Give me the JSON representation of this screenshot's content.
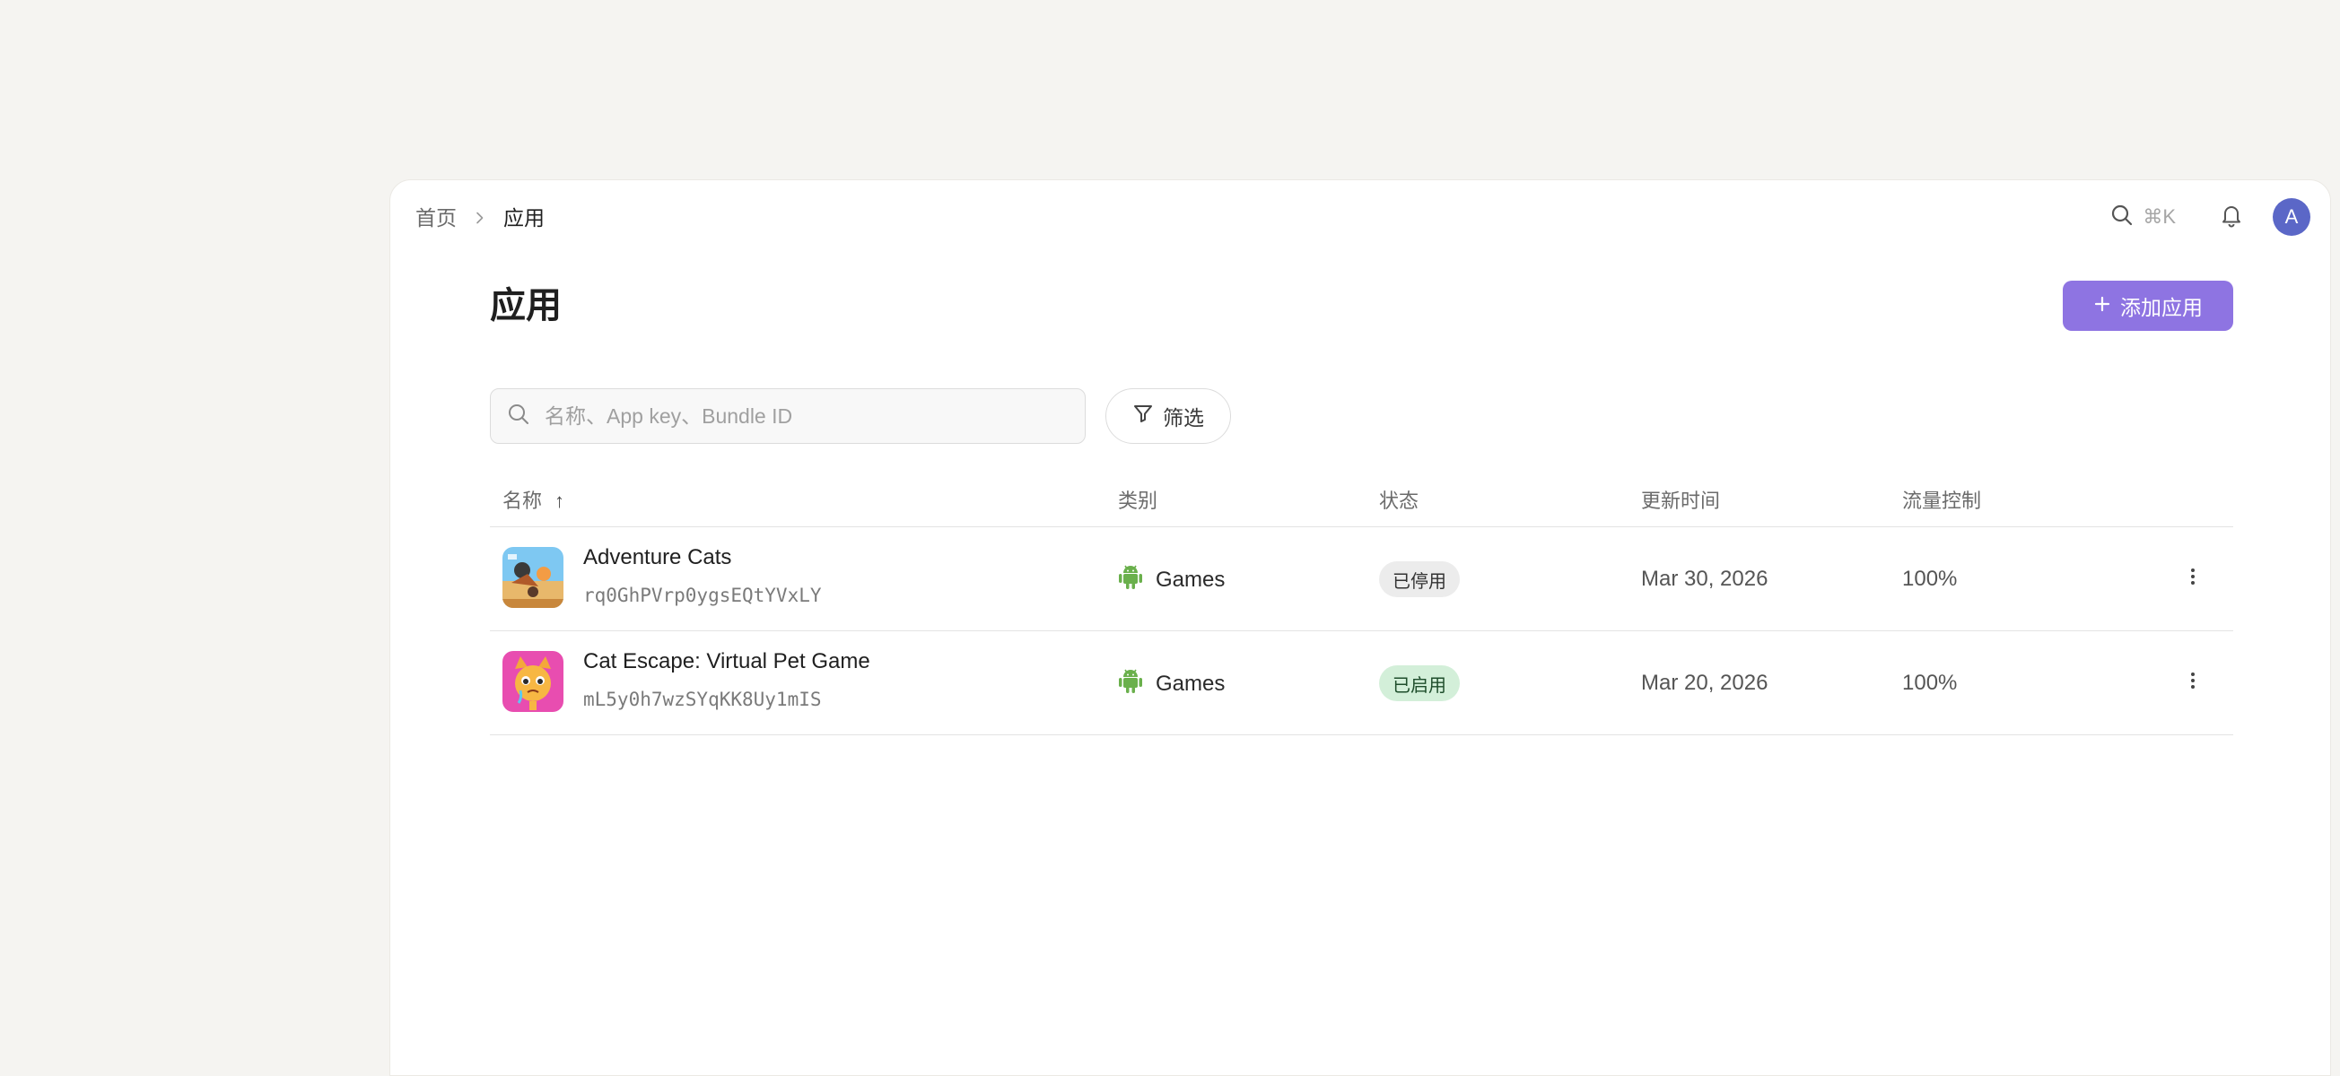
{
  "breadcrumb": {
    "home": "首页",
    "current": "应用"
  },
  "topbar": {
    "search_shortcut": "⌘K",
    "avatar_letter": "A"
  },
  "page": {
    "title": "应用",
    "add_button": "添加应用"
  },
  "search": {
    "placeholder": "名称、App key、Bundle ID",
    "value": ""
  },
  "filter": {
    "label": "筛选"
  },
  "table": {
    "columns": {
      "name": "名称",
      "sort_indicator": "↑",
      "category": "类别",
      "status": "状态",
      "updated": "更新时间",
      "traffic": "流量控制"
    },
    "rows": [
      {
        "name": "Adventure Cats",
        "key": "rq0GhPVrp0ygsEQtYVxLY",
        "platform_icon": "android-icon",
        "category": "Games",
        "status": "已停用",
        "updated": "Mar 30, 2026",
        "traffic": "100%"
      },
      {
        "name": "Cat Escape: Virtual Pet Game",
        "key": "mL5y0h7wzSYqKK8Uy1mIS",
        "platform_icon": "android-icon",
        "category": "Games",
        "status": "已启用",
        "updated": "Mar 20, 2026",
        "traffic": "100%"
      }
    ]
  },
  "colors": {
    "accent": "#8e74e2",
    "avatar": "#5b67c7",
    "android": "#6ab04c",
    "status_off_bg": "#ececec",
    "status_on_bg": "#d3efd9"
  }
}
